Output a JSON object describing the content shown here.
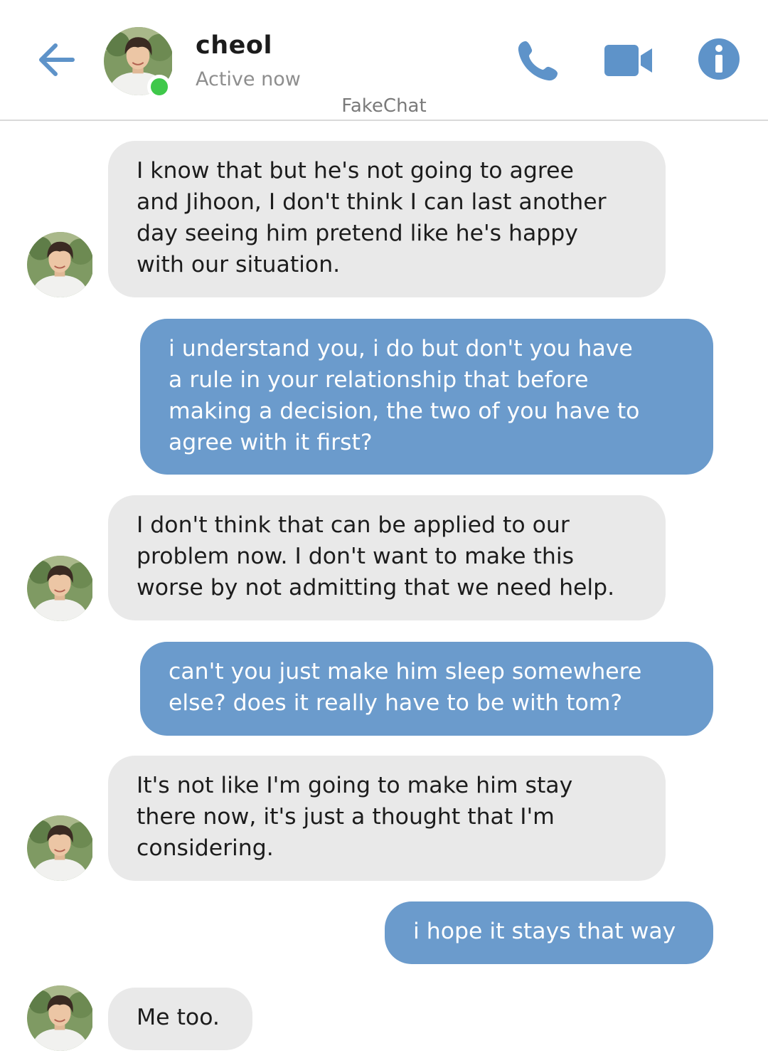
{
  "header": {
    "contact_name": "cheol",
    "status": "Active now",
    "app_name": "FakeChat",
    "icons": [
      "back-arrow-icon",
      "phone-icon",
      "video-camera-icon",
      "info-icon"
    ]
  },
  "colors": {
    "accent": "#6b9bcc",
    "incoming_bubble": "#e9e9e9",
    "online_dot": "#3fc84a"
  },
  "messages": [
    {
      "sender": "contact",
      "text": "I know that but he's not going to agree\nand Jihoon, I don't think I can last another\nday seeing him pretend like he's happy\nwith our situation."
    },
    {
      "sender": "me",
      "text": "i understand you, i do but don't you have\na rule in your relationship that before\nmaking a decision, the two of you have to\nagree with it first?"
    },
    {
      "sender": "contact",
      "text": "I don't think that can be applied to our\nproblem now. I don't want to make this\nworse by not admitting that we need help."
    },
    {
      "sender": "me",
      "text": "can't you just make him sleep somewhere\nelse? does it really have to be with tom?"
    },
    {
      "sender": "contact",
      "text": "It's not like I'm going to make him stay\nthere now, it's just a thought that I'm\nconsidering."
    },
    {
      "sender": "me",
      "text": "i hope it stays that way"
    },
    {
      "sender": "contact",
      "text": "Me too."
    }
  ]
}
